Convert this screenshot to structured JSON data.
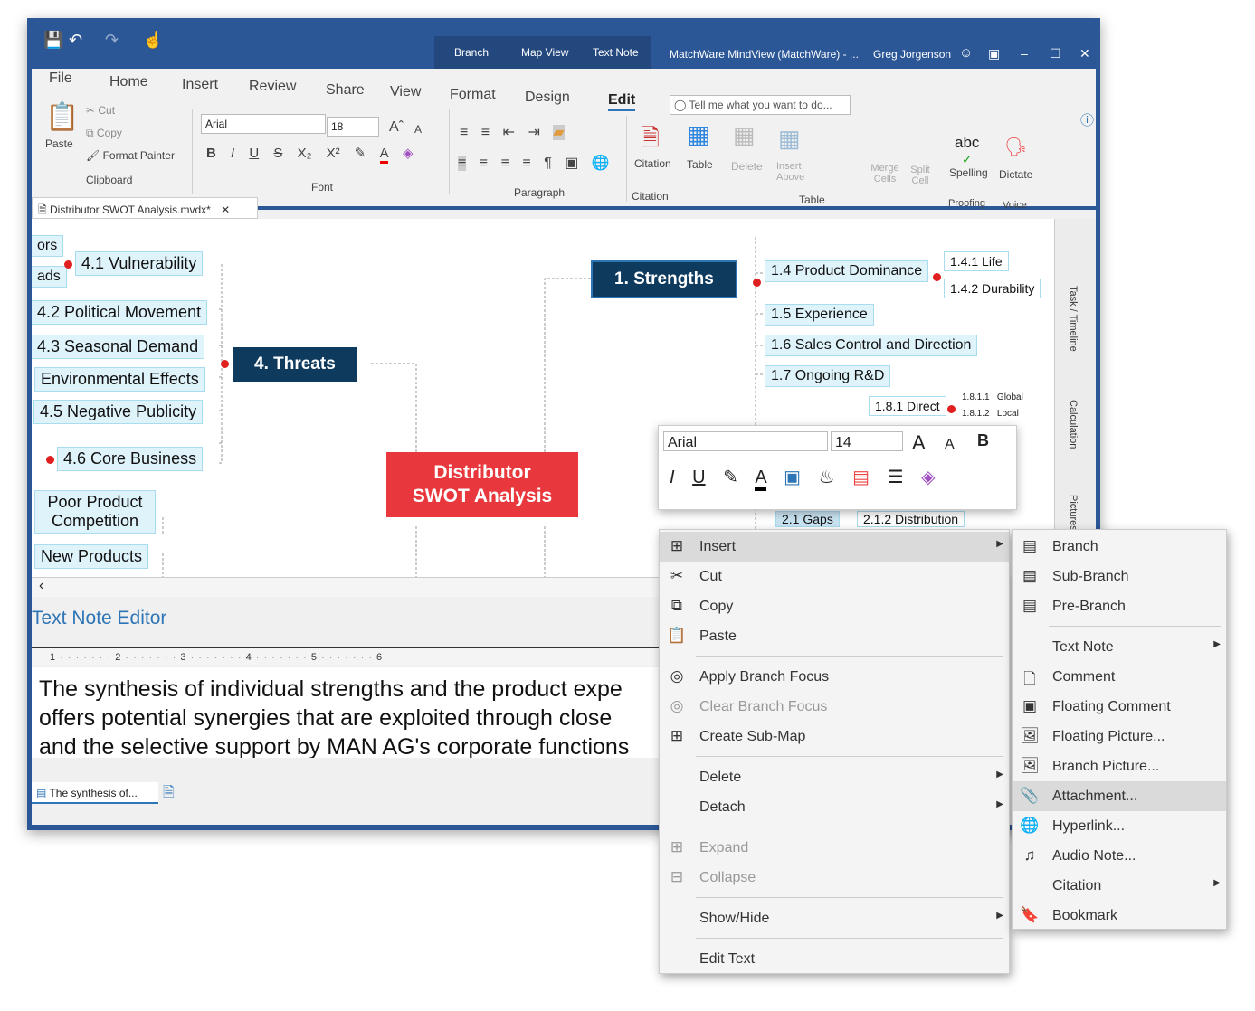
{
  "titlebar": {
    "context_tabs": [
      "Branch",
      "Map View",
      "Text Note"
    ],
    "title": "MatchWare MindView (MatchWare) - ...",
    "user": "Greg Jorgenson"
  },
  "ribbon": {
    "tabs": [
      "File",
      "Home",
      "Insert",
      "Review",
      "Share",
      "View",
      "Format",
      "Design",
      "Edit"
    ],
    "active_tab": "Edit",
    "search_placeholder": "Tell me what you want to do...",
    "clipboard": {
      "paste": "Paste",
      "cut": "Cut",
      "copy": "Copy",
      "format_painter": "Format Painter",
      "group": "Clipboard"
    },
    "font": {
      "name": "Arial",
      "size": "18",
      "group": "Font"
    },
    "paragraph": {
      "group": "Paragraph"
    },
    "citation": {
      "label": "Citation",
      "group": "Citation"
    },
    "table": {
      "table": "Table",
      "delete": "Delete",
      "insert_above": "Insert Above",
      "merge": "Merge Cells",
      "split": "Split Cell",
      "group": "Table"
    },
    "proofing": {
      "spelling": "Spelling",
      "abc": "abc",
      "group": "Proofing"
    },
    "voice": {
      "dictate": "Dictate",
      "group": "Voice"
    }
  },
  "document_tab": "Distributor SWOT Analysis.mvdx*",
  "mindmap": {
    "center": "Distributor SWOT Analysis",
    "strengths": "1.  Strengths",
    "threats": "4.  Threats",
    "left_nodes": [
      "4.1  Vulnerability",
      "4.2  Political Movement",
      "4.3  Seasonal Demand",
      "Environmental Effects",
      "4.5  Negative Publicity",
      "4.6  Core Business",
      "Poor Product Competition",
      "New Products"
    ],
    "left_cut": [
      "ors",
      "ads"
    ],
    "right_nodes": [
      "1.4  Product Dominance",
      "1.5  Experience",
      "1.6  Sales Control and Direction",
      "1.7  Ongoing R&D",
      "1.8.1 Direct"
    ],
    "sub_nodes": [
      "1.4.1 Life",
      "1.4.2 Durability"
    ],
    "small": [
      "1.8.1.1   Global",
      "1.8.1.2   Local"
    ],
    "bottom_cut": [
      "2.1  Gaps",
      "2.1.2 Distribution"
    ]
  },
  "side_tabs": [
    "Task / Timeline",
    "Calculation",
    "Pictures"
  ],
  "mini_toolbar": {
    "font": "Arial",
    "size": "14"
  },
  "text_note": {
    "title": "Text Note Editor",
    "ruler": "1 · · · · · · · 2 · · · · · · · 3 · · · · · · · 4 · · · · · · · 5 · · · · · · · 6",
    "lines": [
      "The synthesis of individual strengths and the product expe",
      "offers potential synergies that are exploited through close",
      "and the selective support by MAN AG's corporate functions"
    ],
    "tab": "The synthesis of..."
  },
  "context_menu": [
    {
      "label": "Insert",
      "icon": "insert-icon",
      "submenu": true,
      "highlight": true
    },
    {
      "label": "Cut",
      "icon": "scissors-icon"
    },
    {
      "label": "Copy",
      "icon": "copy-icon"
    },
    {
      "label": "Paste",
      "icon": "paste-icon"
    },
    {
      "label": "Apply Branch Focus",
      "icon": "target-icon"
    },
    {
      "label": "Clear Branch Focus",
      "icon": "target-icon",
      "disabled": true
    },
    {
      "label": "Create Sub-Map",
      "icon": "submap-icon"
    },
    {
      "label": "Delete",
      "submenu": true
    },
    {
      "label": "Detach",
      "submenu": true
    },
    {
      "label": "Expand",
      "icon": "expand-icon",
      "disabled": true
    },
    {
      "label": "Collapse",
      "icon": "collapse-icon",
      "disabled": true
    },
    {
      "label": "Show/Hide",
      "submenu": true
    },
    {
      "label": "Edit Text"
    }
  ],
  "submenu": [
    {
      "label": "Branch",
      "icon": "branch-icon"
    },
    {
      "label": "Sub-Branch",
      "icon": "sub-branch-icon"
    },
    {
      "label": "Pre-Branch",
      "icon": "pre-branch-icon"
    },
    {
      "label": "Text Note",
      "submenu": true
    },
    {
      "label": "Comment",
      "icon": "comment-icon"
    },
    {
      "label": "Floating Comment",
      "icon": "floating-comment-icon"
    },
    {
      "label": "Floating Picture...",
      "icon": "picture-icon"
    },
    {
      "label": "Branch Picture...",
      "icon": "picture-icon"
    },
    {
      "label": "Attachment...",
      "icon": "attachment-icon",
      "highlight": true
    },
    {
      "label": "Hyperlink...",
      "icon": "globe-icon"
    },
    {
      "label": "Audio Note...",
      "icon": "audio-icon"
    },
    {
      "label": "Citation",
      "submenu": true
    },
    {
      "label": "Bookmark",
      "icon": "bookmark-icon"
    }
  ],
  "colors": {
    "titlebar": "#2b5797",
    "center": "#e8383d",
    "main_branch": "#0e3a5e",
    "node": "#dff3fb",
    "accent": "#2e75b6"
  }
}
